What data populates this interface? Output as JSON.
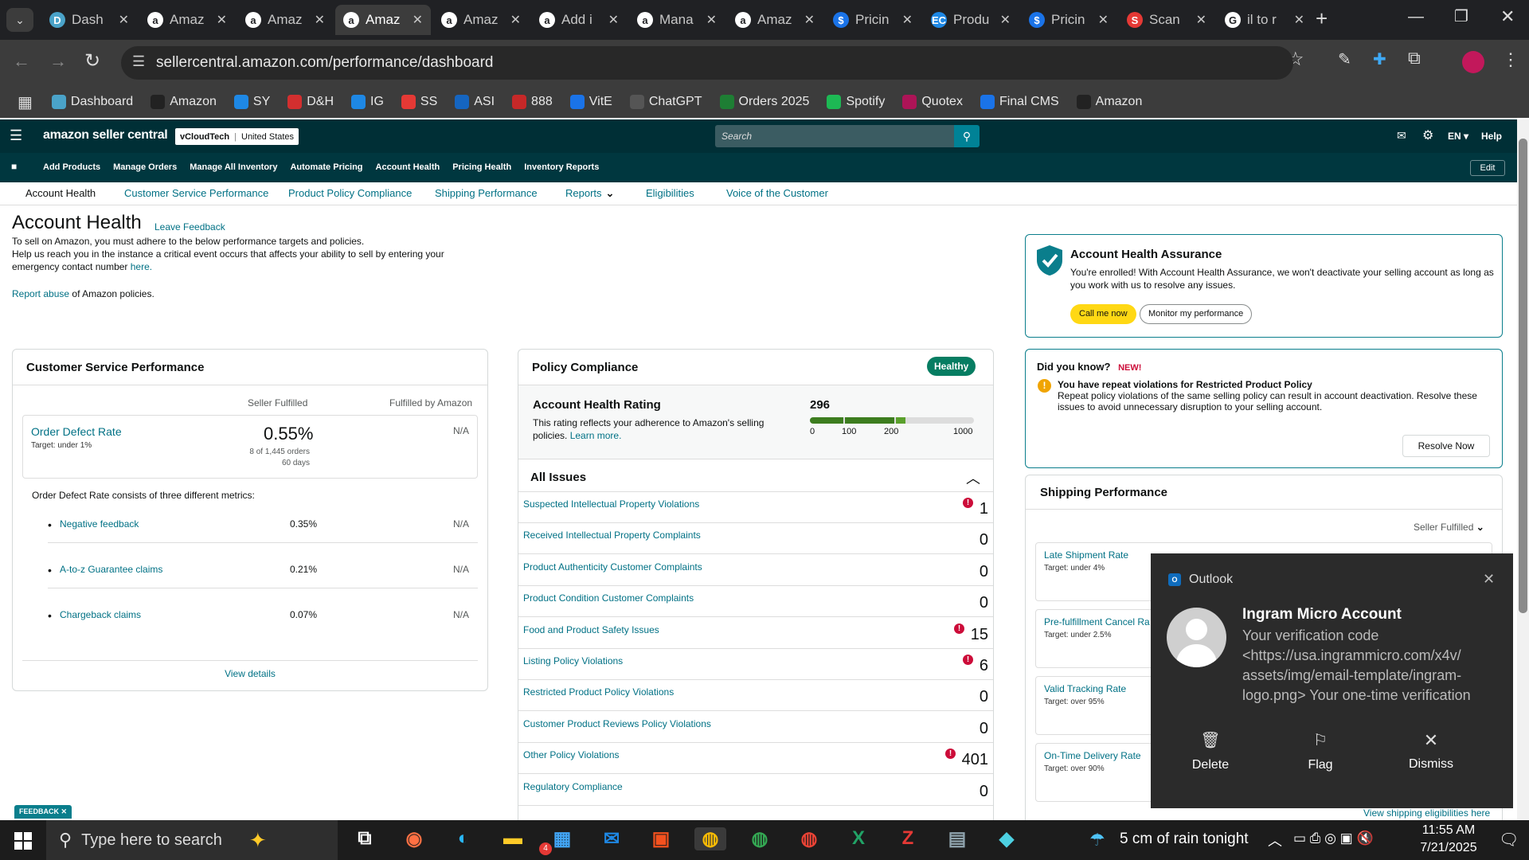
{
  "tabs": [
    {
      "title": "Dash",
      "icon": "D",
      "color": "#4aa3c9"
    },
    {
      "title": "Amaz",
      "icon": "a",
      "color": "#fff"
    },
    {
      "title": "Amaz",
      "icon": "a",
      "color": "#fff"
    },
    {
      "title": "Amaz",
      "icon": "a",
      "color": "#fff"
    },
    {
      "title": "Amaz",
      "icon": "a",
      "color": "#fff"
    },
    {
      "title": "Add i",
      "icon": "a",
      "color": "#fff"
    },
    {
      "title": "Mana",
      "icon": "a",
      "color": "#fff"
    },
    {
      "title": "Amaz",
      "icon": "a",
      "color": "#fff"
    },
    {
      "title": "Pricin",
      "icon": "$",
      "color": "#1a73e8"
    },
    {
      "title": "Produ",
      "icon": "EC",
      "color": "#1e88e5"
    },
    {
      "title": "Pricin",
      "icon": "$",
      "color": "#1a73e8"
    },
    {
      "title": "Scan",
      "icon": "S",
      "color": "#e53935"
    },
    {
      "title": "il to r",
      "icon": "G",
      "color": "#fff"
    }
  ],
  "url": "sellercentral.amazon.com/performance/dashboard",
  "bookmarks": [
    {
      "label": "Dashboard",
      "color": "#4aa3c9"
    },
    {
      "label": "Amazon",
      "color": "#222"
    },
    {
      "label": "SY",
      "color": "#1e88e5"
    },
    {
      "label": "D&H",
      "color": "#d32f2f"
    },
    {
      "label": "IG",
      "color": "#1e88e5"
    },
    {
      "label": "SS",
      "color": "#e53935"
    },
    {
      "label": "ASI",
      "color": "#1565c0"
    },
    {
      "label": "888",
      "color": "#c62828"
    },
    {
      "label": "VitE",
      "color": "#1a73e8"
    },
    {
      "label": "ChatGPT",
      "color": "#555"
    },
    {
      "label": "Orders 2025",
      "color": "#1e7e34"
    },
    {
      "label": "Spotify",
      "color": "#1db954"
    },
    {
      "label": "Quotex",
      "color": "#ad1457"
    },
    {
      "label": "Final CMS",
      "color": "#1a73e8"
    },
    {
      "label": "Amazon",
      "color": "#222"
    }
  ],
  "header": {
    "logo": "amazon seller central",
    "store": "vCloudTech",
    "region": "United States",
    "search_placeholder": "Search",
    "lang": "EN",
    "help": "Help"
  },
  "nav": [
    "Add Products",
    "Manage Orders",
    "Manage All Inventory",
    "Automate Pricing",
    "Account Health",
    "Pricing Health",
    "Inventory Reports"
  ],
  "nav_edit": "Edit",
  "subnav": [
    "Account Health",
    "Customer Service Performance",
    "Product Policy Compliance",
    "Shipping Performance",
    "Reports",
    "Eligibilities",
    "Voice of the Customer"
  ],
  "page": {
    "title": "Account Health",
    "leave_feedback": "Leave Feedback",
    "line1": "To sell on Amazon, you must adhere to the below performance targets and policies.",
    "line2": "Help us reach you in the instance a critical event occurs that affects your ability to sell by entering your",
    "line3": "emergency contact number",
    "here": "here.",
    "report_abuse": "Report abuse",
    "report_suffix": "of Amazon policies."
  },
  "csp": {
    "title": "Customer Service Performance",
    "col1": "Seller Fulfilled",
    "col2": "Fulfilled by Amazon",
    "odr_label": "Order Defect Rate",
    "odr_target": "Target: under 1%",
    "odr_value": "0.55%",
    "odr_orders": "8 of 1,445 orders",
    "odr_days": "60 days",
    "odr_fba": "N/A",
    "desc": "Order Defect Rate consists of three different metrics:",
    "metrics": [
      {
        "label": "Negative feedback",
        "value": "0.35%",
        "fba": "N/A"
      },
      {
        "label": "A-to-z Guarantee claims",
        "value": "0.21%",
        "fba": "N/A"
      },
      {
        "label": "Chargeback claims",
        "value": "0.07%",
        "fba": "N/A"
      }
    ],
    "view_details": "View details"
  },
  "policy": {
    "title": "Policy Compliance",
    "badge": "Healthy",
    "ahr_title": "Account Health Rating",
    "ahr_desc1": "This rating reflects your adherence to Amazon's selling",
    "ahr_desc2": "policies.",
    "learn_more": "Learn more.",
    "score": "296",
    "ticks": [
      "0",
      "100",
      "200",
      "1000"
    ],
    "all_issues": "All Issues",
    "issues": [
      {
        "label": "Suspected Intellectual Property Violations",
        "count": "1",
        "alert": true
      },
      {
        "label": "Received Intellectual Property Complaints",
        "count": "0",
        "alert": false
      },
      {
        "label": "Product Authenticity Customer Complaints",
        "count": "0",
        "alert": false
      },
      {
        "label": "Product Condition Customer Complaints",
        "count": "0",
        "alert": false
      },
      {
        "label": "Food and Product Safety Issues",
        "count": "15",
        "alert": true
      },
      {
        "label": "Listing Policy Violations",
        "count": "6",
        "alert": true
      },
      {
        "label": "Restricted Product Policy Violations",
        "count": "0",
        "alert": false
      },
      {
        "label": "Customer Product Reviews Policy Violations",
        "count": "0",
        "alert": false
      },
      {
        "label": "Other Policy Violations",
        "count": "401",
        "alert": true
      },
      {
        "label": "Regulatory Compliance",
        "count": "0",
        "alert": false
      }
    ]
  },
  "aha": {
    "title": "Account Health Assurance",
    "desc1": "You're enrolled! With Account Health Assurance, we won't deactivate your selling account as long as",
    "desc2": "you work with us to resolve any issues.",
    "call": "Call me now",
    "monitor": "Monitor my performance"
  },
  "dyk": {
    "title": "Did you know?",
    "new": "NEW!",
    "bold": "You have repeat violations for Restricted Product Policy",
    "desc1": "Repeat policy violations of the same selling policy can result in account deactivation. Resolve these",
    "desc2": "issues to avoid unnecessary disruption to your selling account.",
    "resolve": "Resolve Now"
  },
  "ship": {
    "title": "Shipping Performance",
    "filter": "Seller Fulfilled",
    "rows": [
      {
        "label": "Late Shipment Rate",
        "target": "Target: under 4%"
      },
      {
        "label": "Pre-fulfillment Cancel Ra",
        "target": "Target: under 2.5%"
      },
      {
        "label": "Valid Tracking Rate",
        "target": "Target: over 95%"
      },
      {
        "label": "On-Time Delivery Rate",
        "target": "Target: over 90%"
      }
    ],
    "link": "View shipping eligibilities here"
  },
  "feedback_tab": "FEEDBACK",
  "toast": {
    "app": "Outlook",
    "sender": "Ingram Micro Account",
    "body": [
      "Your verification code",
      "<https://usa.ingrammicro.com/x4v/",
      "assets/img/email-template/ingram-",
      "logo.png>   Your one-time verification"
    ],
    "delete": "Delete",
    "flag": "Flag",
    "dismiss": "Dismiss"
  },
  "taskbar": {
    "search": "Type here to search",
    "weather": "5 cm of rain tonight",
    "time": "11:55 AM",
    "date": "7/21/2025",
    "badge": "4"
  }
}
